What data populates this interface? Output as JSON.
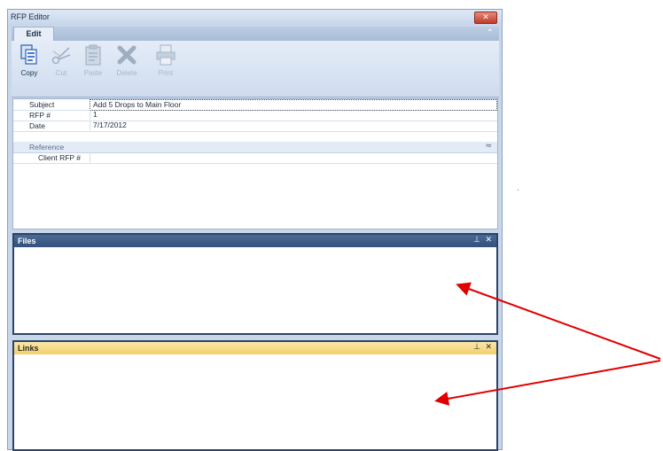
{
  "window": {
    "title": "RFP Editor",
    "close_glyph": "✕"
  },
  "ribbon": {
    "tab": "Edit",
    "collapse_glyph": "⌃",
    "buttons": [
      {
        "label": "Copy",
        "icon": "copy-icon",
        "enabled": true
      },
      {
        "label": "Cut",
        "icon": "scissors-icon",
        "enabled": false
      },
      {
        "label": "Paste",
        "icon": "clipboard-icon",
        "enabled": false
      },
      {
        "label": "Delete",
        "icon": "delete-x-icon",
        "enabled": false
      },
      {
        "label": "Print",
        "icon": "printer-icon",
        "enabled": false
      }
    ]
  },
  "properties": {
    "rows": [
      {
        "key": "Subject",
        "value": "Add 5 Drops to Main Floor"
      },
      {
        "key": "RFP #",
        "value": "1"
      },
      {
        "key": "Date",
        "value": "7/17/2012"
      }
    ],
    "category": {
      "label": "Reference",
      "collapse_glyph": "≈"
    },
    "sub_rows": [
      {
        "key": "Client RFP #",
        "value": ""
      }
    ]
  },
  "panels": {
    "files": {
      "title": "Files",
      "pin_glyph": "⊥",
      "close_glyph": "✕"
    },
    "links": {
      "title": "Links",
      "pin_glyph": "⊥",
      "close_glyph": "✕"
    }
  },
  "colors": {
    "files_header": "#3b5a86",
    "links_header": "#f5d97f",
    "arrow": "#e00000"
  }
}
